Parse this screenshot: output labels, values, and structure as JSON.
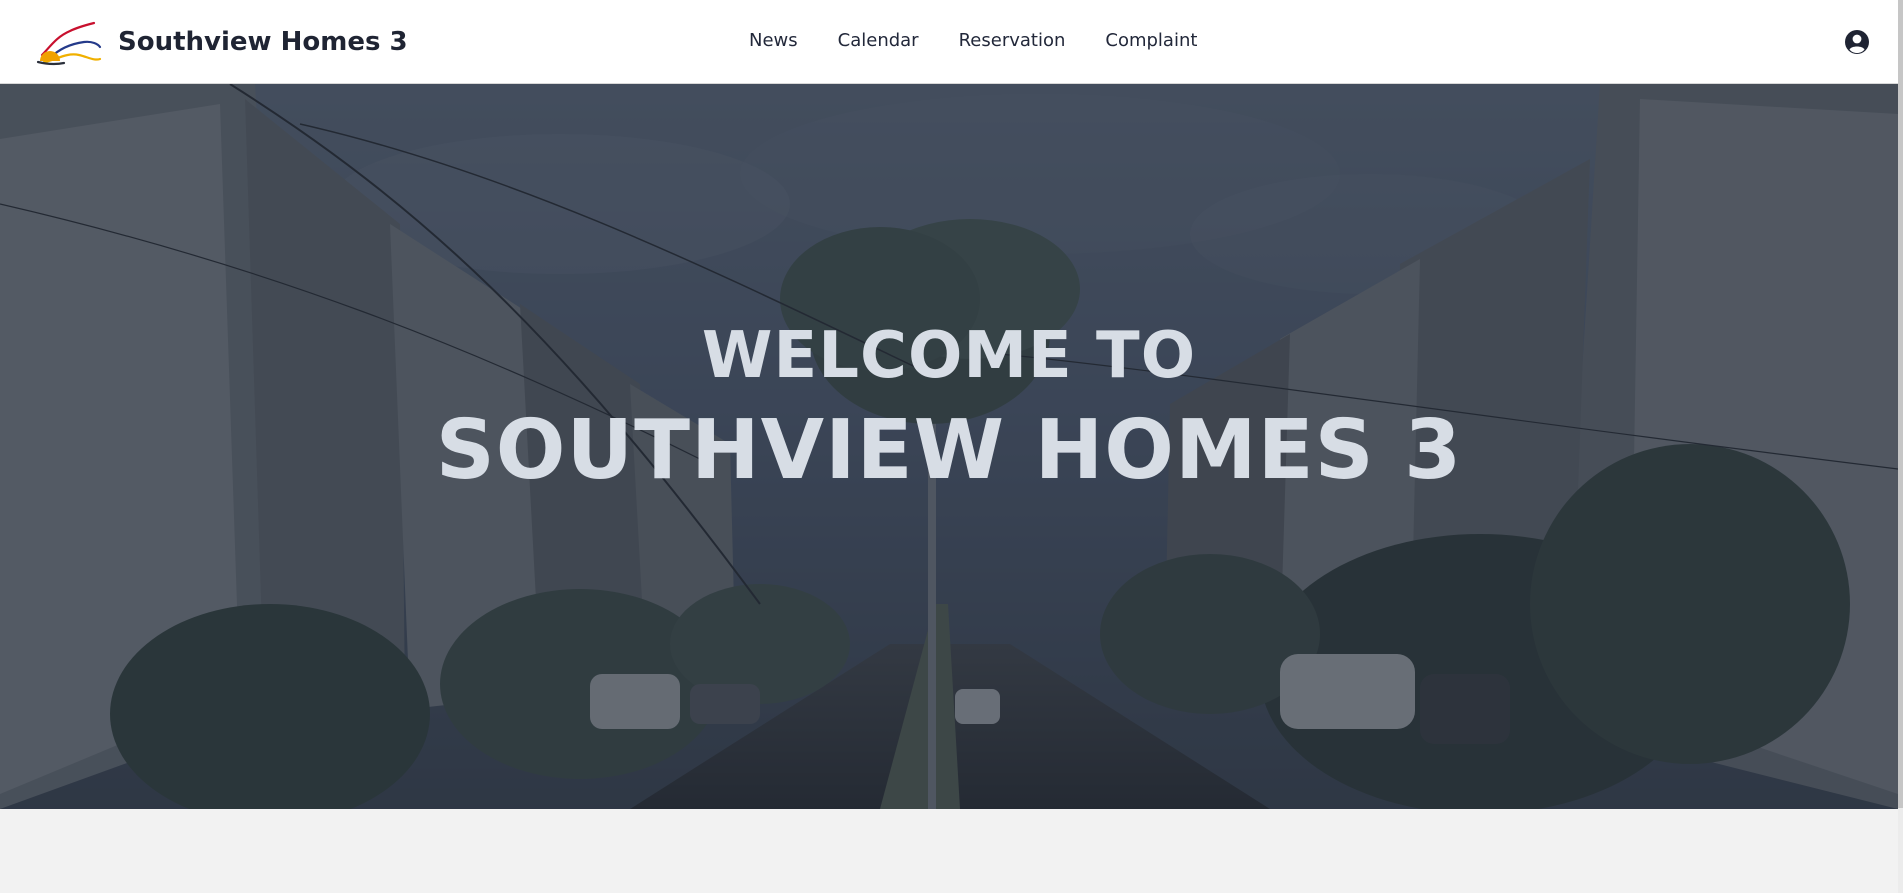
{
  "header": {
    "title": "Southview Homes 3",
    "nav": [
      {
        "label": "News"
      },
      {
        "label": "Calendar"
      },
      {
        "label": "Reservation"
      },
      {
        "label": "Complaint"
      }
    ],
    "account_icon": "user-circle-icon"
  },
  "hero": {
    "line1": "WELCOME TO",
    "line2": "SOUTHVIEW HOMES 3"
  },
  "colors": {
    "header_bg": "#ffffff",
    "text_dark": "#1f2433",
    "hero_text": "#d7dde5",
    "page_bg": "#f2f2f2"
  }
}
